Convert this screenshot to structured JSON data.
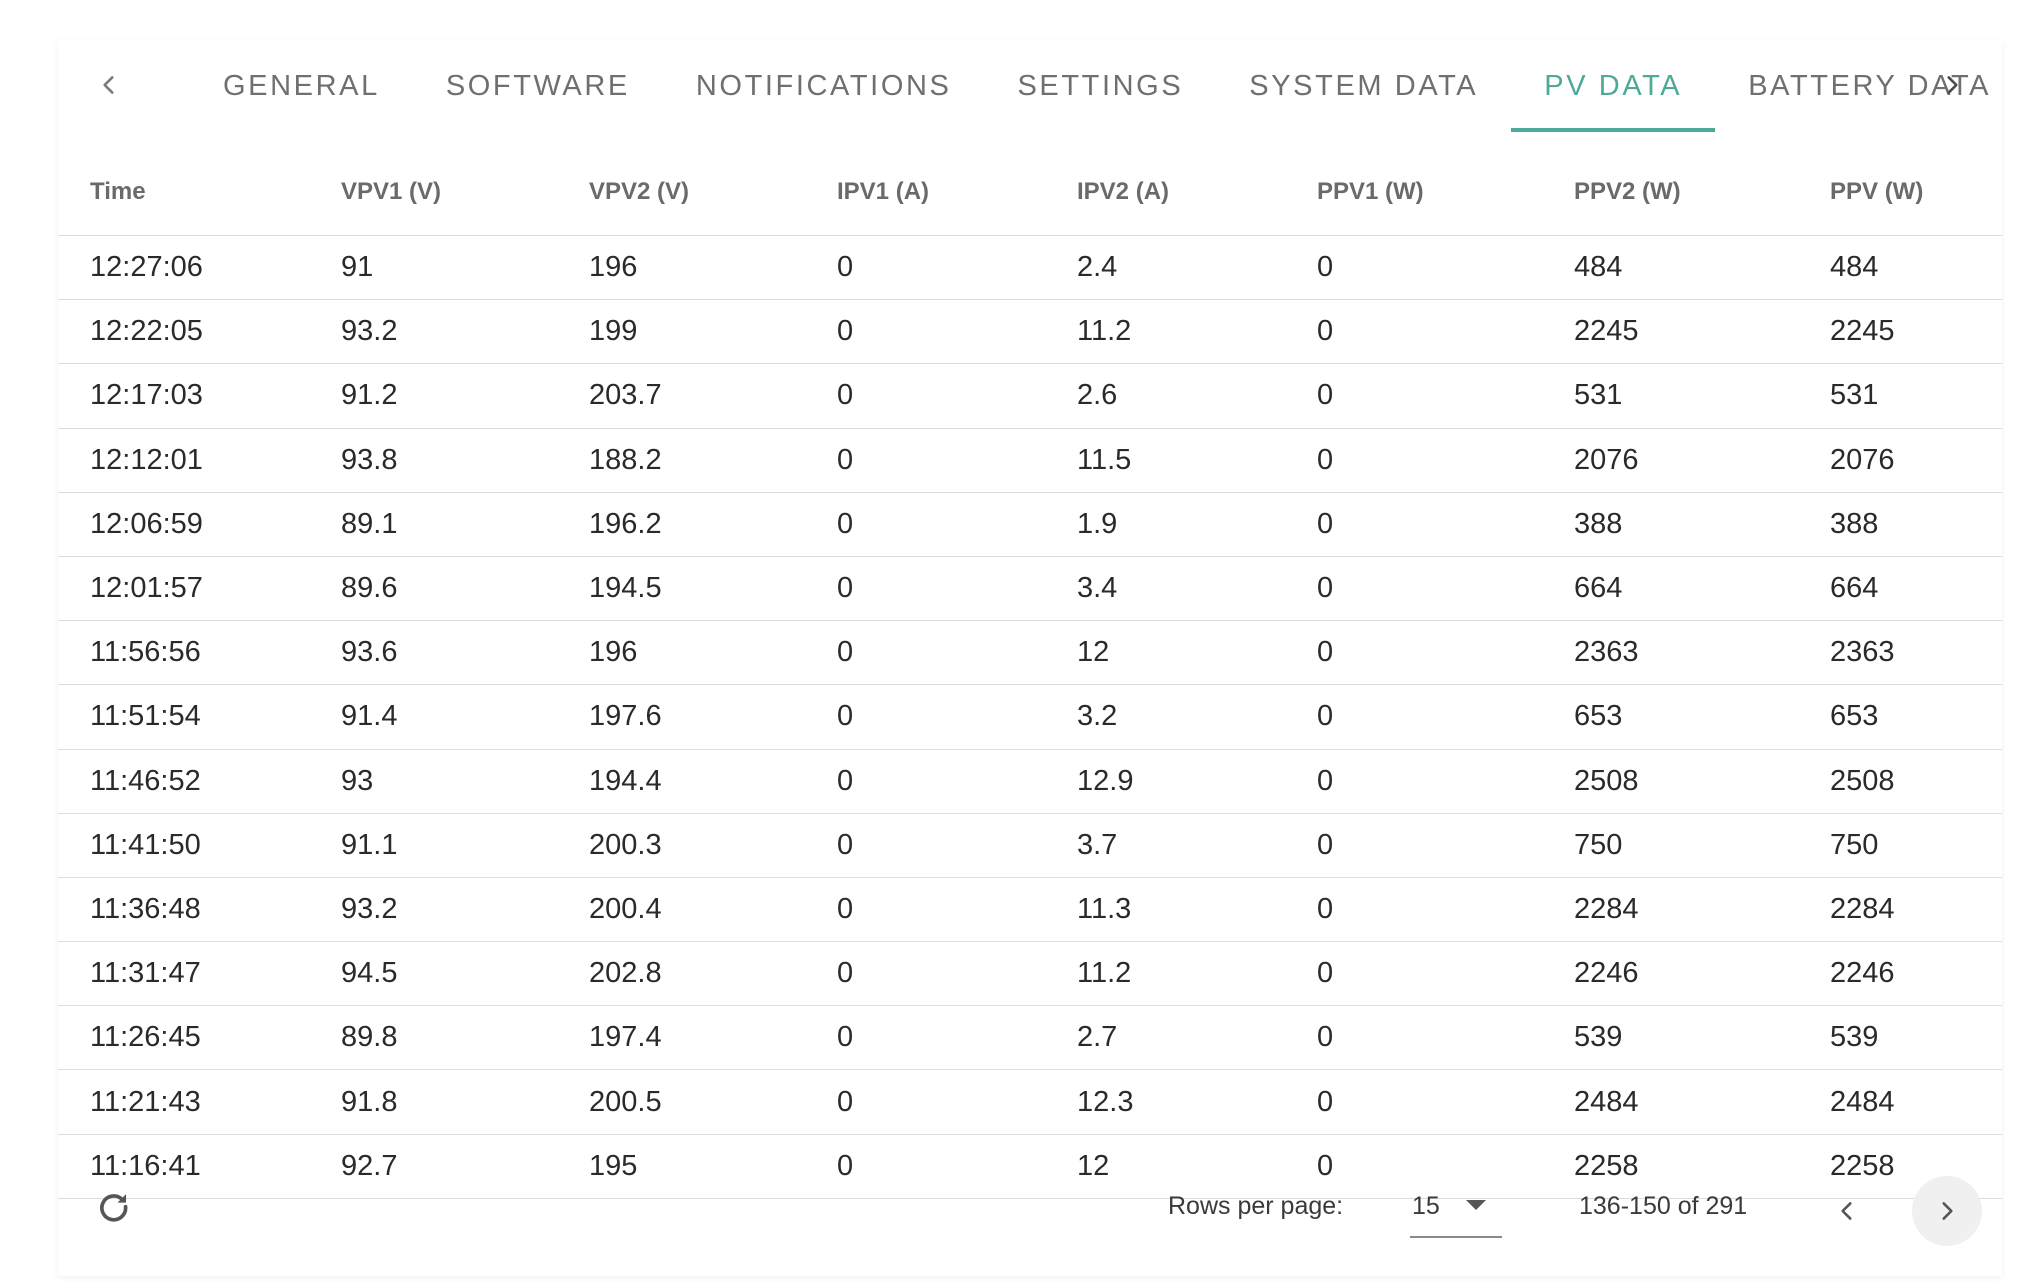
{
  "tabs": {
    "items": [
      {
        "label": "GENERAL",
        "active": false
      },
      {
        "label": "SOFTWARE",
        "active": false
      },
      {
        "label": "NOTIFICATIONS",
        "active": false
      },
      {
        "label": "SETTINGS",
        "active": false
      },
      {
        "label": "SYSTEM DATA",
        "active": false
      },
      {
        "label": "PV DATA",
        "active": true
      },
      {
        "label": "BATTERY DATA",
        "active": false
      }
    ],
    "prev_icon": "chevron-left-icon",
    "next_icon": "chevron-right-icon",
    "accent_color": "#4eaa98"
  },
  "table": {
    "columns": [
      "Time",
      "VPV1 (V)",
      "VPV2 (V)",
      "IPV1 (A)",
      "IPV2 (A)",
      "PPV1 (W)",
      "PPV2 (W)",
      "PPV (W)"
    ],
    "rows": [
      [
        "12:27:06",
        "91",
        "196",
        "0",
        "2.4",
        "0",
        "484",
        "484"
      ],
      [
        "12:22:05",
        "93.2",
        "199",
        "0",
        "11.2",
        "0",
        "2245",
        "2245"
      ],
      [
        "12:17:03",
        "91.2",
        "203.7",
        "0",
        "2.6",
        "0",
        "531",
        "531"
      ],
      [
        "12:12:01",
        "93.8",
        "188.2",
        "0",
        "11.5",
        "0",
        "2076",
        "2076"
      ],
      [
        "12:06:59",
        "89.1",
        "196.2",
        "0",
        "1.9",
        "0",
        "388",
        "388"
      ],
      [
        "12:01:57",
        "89.6",
        "194.5",
        "0",
        "3.4",
        "0",
        "664",
        "664"
      ],
      [
        "11:56:56",
        "93.6",
        "196",
        "0",
        "12",
        "0",
        "2363",
        "2363"
      ],
      [
        "11:51:54",
        "91.4",
        "197.6",
        "0",
        "3.2",
        "0",
        "653",
        "653"
      ],
      [
        "11:46:52",
        "93",
        "194.4",
        "0",
        "12.9",
        "0",
        "2508",
        "2508"
      ],
      [
        "11:41:50",
        "91.1",
        "200.3",
        "0",
        "3.7",
        "0",
        "750",
        "750"
      ],
      [
        "11:36:48",
        "93.2",
        "200.4",
        "0",
        "11.3",
        "0",
        "2284",
        "2284"
      ],
      [
        "11:31:47",
        "94.5",
        "202.8",
        "0",
        "11.2",
        "0",
        "2246",
        "2246"
      ],
      [
        "11:26:45",
        "89.8",
        "197.4",
        "0",
        "2.7",
        "0",
        "539",
        "539"
      ],
      [
        "11:21:43",
        "91.8",
        "200.5",
        "0",
        "12.3",
        "0",
        "2484",
        "2484"
      ],
      [
        "11:16:41",
        "92.7",
        "195",
        "0",
        "12",
        "0",
        "2258",
        "2258"
      ]
    ]
  },
  "footer": {
    "refresh_icon": "refresh-icon",
    "rows_per_page_label": "Rows per page:",
    "rows_per_page_value": "15",
    "range_text": "136-150 of 291",
    "prev_page_icon": "chevron-left-icon",
    "next_page_icon": "chevron-right-icon"
  }
}
